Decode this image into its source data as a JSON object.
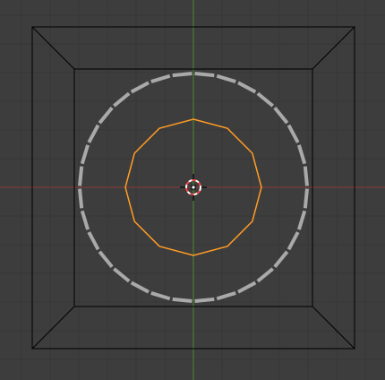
{
  "viewport": {
    "view": "top-orthographic",
    "colors": {
      "background": "#3d3d3d",
      "grid": "#363636",
      "x_axis": "#8a3a3a",
      "y_axis": "#4a8a2a",
      "wire": "#000000",
      "selected_ring": "#ff9c24",
      "unselected_ring": "#a9a9a9",
      "cursor_red": "#ff3f3f",
      "cursor_white": "#ffffff"
    },
    "outer_ring_segments": 32,
    "selected_ring_segments": 12
  }
}
